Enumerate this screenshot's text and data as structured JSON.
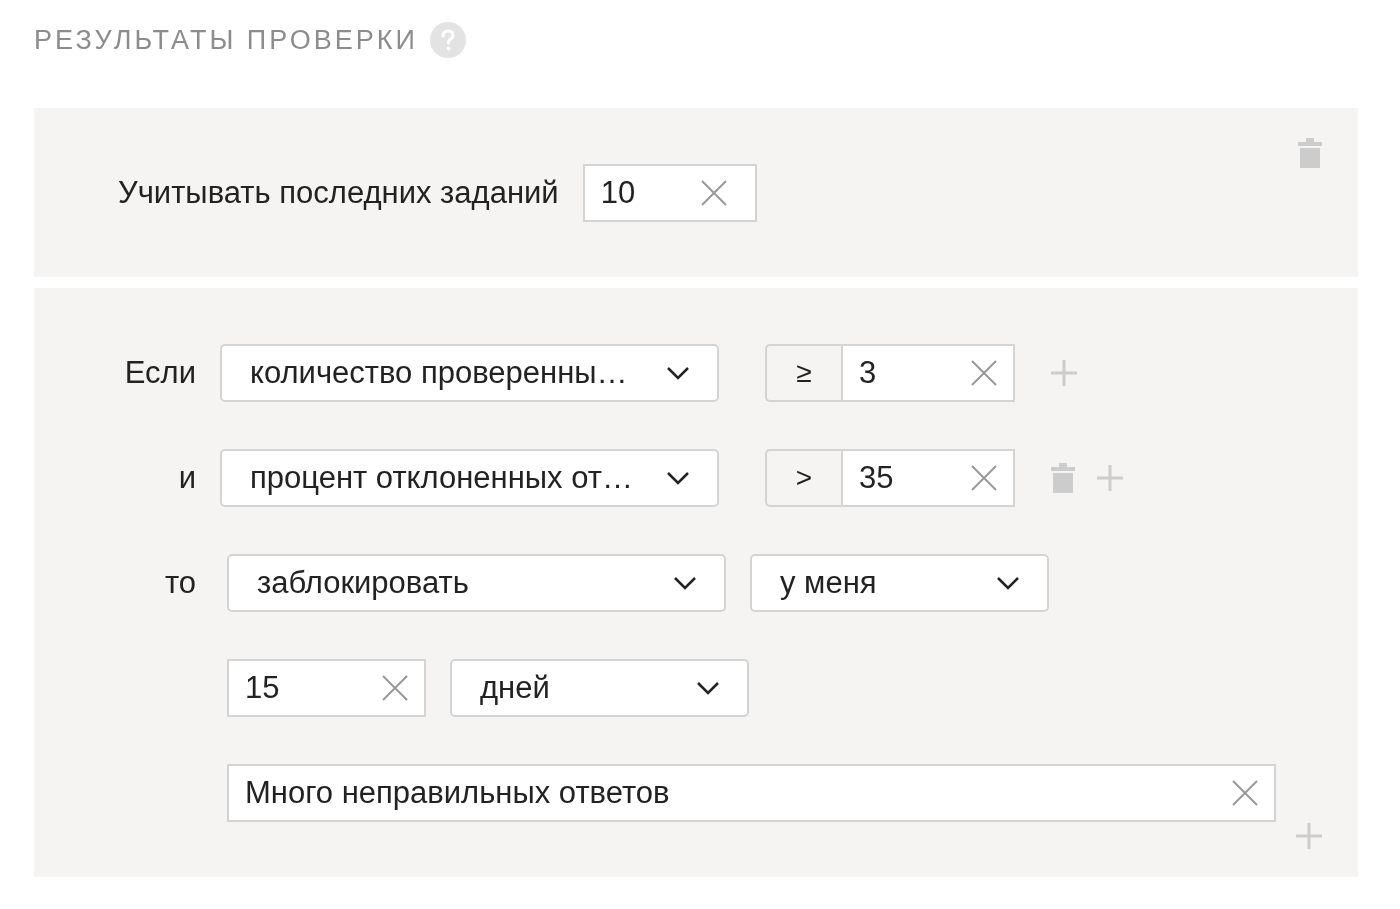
{
  "section": {
    "title": "РЕЗУЛЬТАТЫ ПРОВЕРКИ"
  },
  "history": {
    "label": "Учитывать последних заданий",
    "value": "10"
  },
  "conditions": [
    {
      "connector": "Если",
      "field": "количество проверенны…",
      "operator": "≥",
      "value": "3",
      "deletable": false
    },
    {
      "connector": "и",
      "field": "процент отклоненных от…",
      "operator": ">",
      "value": "35",
      "deletable": true
    }
  ],
  "action": {
    "label": "то",
    "action": "заблокировать",
    "scope": "у меня",
    "duration": "15",
    "unit": "дней",
    "reason": "Много неправильных ответов"
  }
}
